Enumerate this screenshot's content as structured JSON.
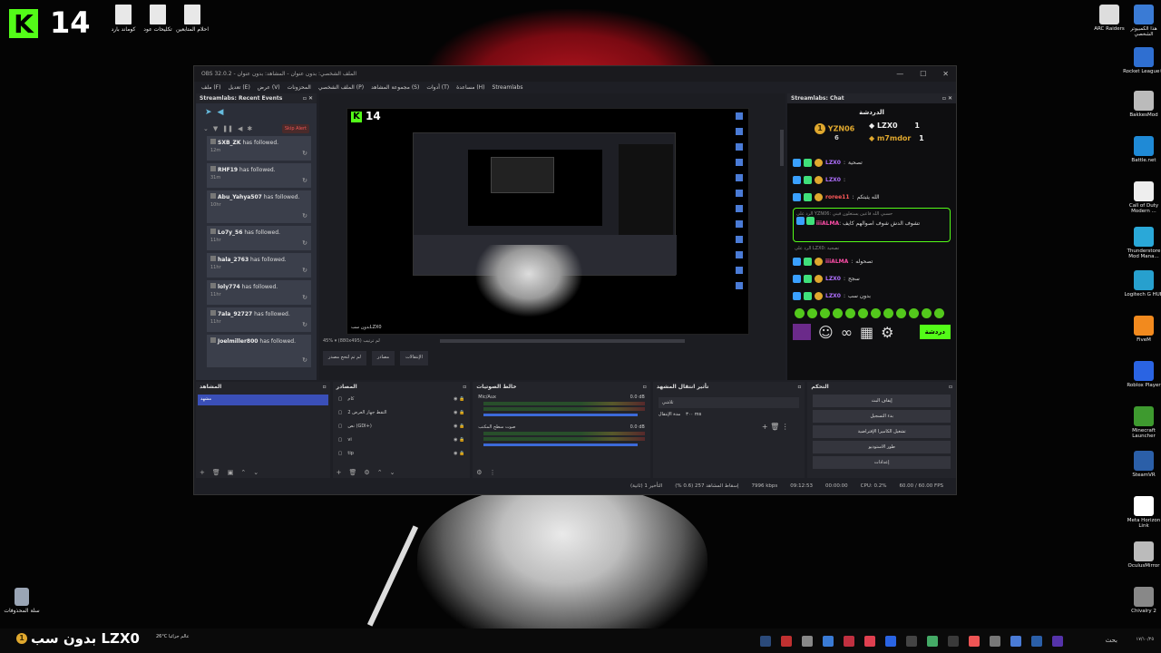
{
  "desktop": {
    "logo_number": "14",
    "left_icons": [
      {
        "label": "كوماند بارد"
      },
      {
        "label": "تكليحات عود"
      },
      {
        "label": "احلام المتابعين"
      }
    ],
    "recycle_bin": "سلة المحذوفات",
    "right_icons": [
      {
        "label": "هذا الكمبيوتر الشخصي",
        "color": "#3a7bd5"
      },
      {
        "label": "ARC Raiders",
        "color": "#dddddd"
      },
      {
        "label": "Rocket League®",
        "color": "#2f6fd1"
      },
      {
        "label": "BakkesMod",
        "color": "#bbbbbb"
      },
      {
        "label": "Battle.net",
        "color": "#1f8ad6"
      },
      {
        "label": "Call of Duty Modern ...",
        "color": "#eeeeee"
      },
      {
        "label": "Thunderstore Mod Mana...",
        "color": "#2aa8d8"
      },
      {
        "label": "Logitech G HUB",
        "color": "#27a0ce"
      },
      {
        "label": "FiveM",
        "color": "#f28a1e"
      },
      {
        "label": "Roblox Player",
        "color": "#2a64e3"
      },
      {
        "label": "Minecraft Launcher",
        "color": "#3e9a2f"
      },
      {
        "label": "SteamVR",
        "color": "#2b5fa8"
      },
      {
        "label": "Meta Horizon Link",
        "color": "#ffffff"
      },
      {
        "label": "OculusMirror",
        "color": "#bbbbbb"
      },
      {
        "label": "Chivalry 2",
        "color": "#888888"
      }
    ]
  },
  "obs": {
    "title": "OBS 32.0.2 - الملف الشخصي: بدون عنوان - المشاهد: بدون عنوان",
    "menu": [
      "ملف (F)",
      "تعديل (E)",
      "عرض (V)",
      "المحزونات",
      "الملف الشخصي (P)",
      "مجموعة المشاهد (S)",
      "أدوات (T)",
      "مساعدة (H)",
      "Streamlabs"
    ],
    "recent_events": {
      "title": "Streamlabs: Recent Events",
      "skip_label": "Skip Alert",
      "items": [
        {
          "name": "SXB_ZK",
          "text": "has followed.",
          "time": "12m"
        },
        {
          "name": "RHF19",
          "text": "has followed.",
          "time": "31m"
        },
        {
          "name": "Abu_Yahya507",
          "text": "has followed.",
          "time": "10hr"
        },
        {
          "name": "Lo7y_56",
          "text": "has followed.",
          "time": "11hr"
        },
        {
          "name": "hala_2763",
          "text": "has followed.",
          "time": "11hr"
        },
        {
          "name": "loly774",
          "text": "has followed.",
          "time": "11hr"
        },
        {
          "name": "7ala_92727",
          "text": "has followed.",
          "time": "11hr"
        },
        {
          "name": "Joelmiller800",
          "text": "has followed.",
          "time": ""
        }
      ]
    },
    "preview": {
      "logo_number": "14",
      "zoom_text": "45% ▾ (880x495) لم ترتيب",
      "mode_buttons": [
        "لم تم لتحج مصدر",
        "مصادر",
        "الإنتقالات"
      ],
      "preview_taskbar_text": "بدون سبLZX0"
    },
    "chat": {
      "title": "Streamlabs: Chat",
      "header": "الدردشة",
      "leaders": [
        {
          "name": "YZN06",
          "count": "6"
        },
        {
          "name": "LZX0",
          "count": "1"
        },
        {
          "name": "m7mdor",
          "count": "1"
        }
      ],
      "messages": [
        {
          "user": "LZX0",
          "text": "تصحية",
          "style": "purple"
        },
        {
          "user": "LZX0",
          "text": "",
          "style": "purple"
        },
        {
          "user": "roree11",
          "text": "الله يثبتكم",
          "style": "red"
        }
      ],
      "highlight_reply": "الرد على YZN06: حسبي الله فاعين يستغلون فيني",
      "highlight_user": "iiiALMA",
      "highlight_text": "تشوف الدش شوف اصوالهم كايف",
      "reply2": "الرد على LZX0: تصحية",
      "messages2": [
        {
          "user": "iiiALMA",
          "text": "تصحوله",
          "style": "pink"
        },
        {
          "user": "LZX0",
          "text": "سجح",
          "style": "purple"
        },
        {
          "user": "LZX0",
          "text": "بدون سب",
          "style": "purple"
        }
      ],
      "send_label": "دردشة"
    },
    "docks": {
      "scenes_title": "المشاهد",
      "scene_item": "مشهد",
      "sources_title": "المصادر",
      "sources": [
        "كام",
        "التقط جهاز العرض 2",
        "نص (GDI+)",
        "vi",
        "tip"
      ],
      "mixer_title": "خالط الصوتيات",
      "mixer": [
        {
          "name": "Mic/Aux",
          "db": "0.0 dB"
        },
        {
          "name": "صوت سطح المكتب",
          "db": "0.0 dB"
        }
      ],
      "transition_title": "تأثير انتقال المشهد",
      "transition_value": "تلاشي",
      "duration_label": "مدة الإنتقال",
      "duration_value": "٣٠٠ ms",
      "controls_title": "التحكم",
      "controls": [
        "إيقاف البث",
        "بدء التسجيل",
        "تشغيل الكاميرا الإفتراضية",
        "طور الاستوديو",
        "إعدادات"
      ]
    },
    "status": {
      "frames": "التأخير 1 (ثانية)",
      "dropped": "إسقاط المشاهد 257 (0.6 %)",
      "bitrate": "7996 kbps",
      "time1": "09:12:53",
      "time2": "00:00:00",
      "cpu": "CPU: 0.2%",
      "fps": "60.00 / 60.00 FPS"
    }
  },
  "taskbar": {
    "left_text": "بدون سب LZX0",
    "weather": "26°C عالم جزائيا",
    "search": "بحث",
    "tray_text": "١٧/١٠/٢٥"
  }
}
